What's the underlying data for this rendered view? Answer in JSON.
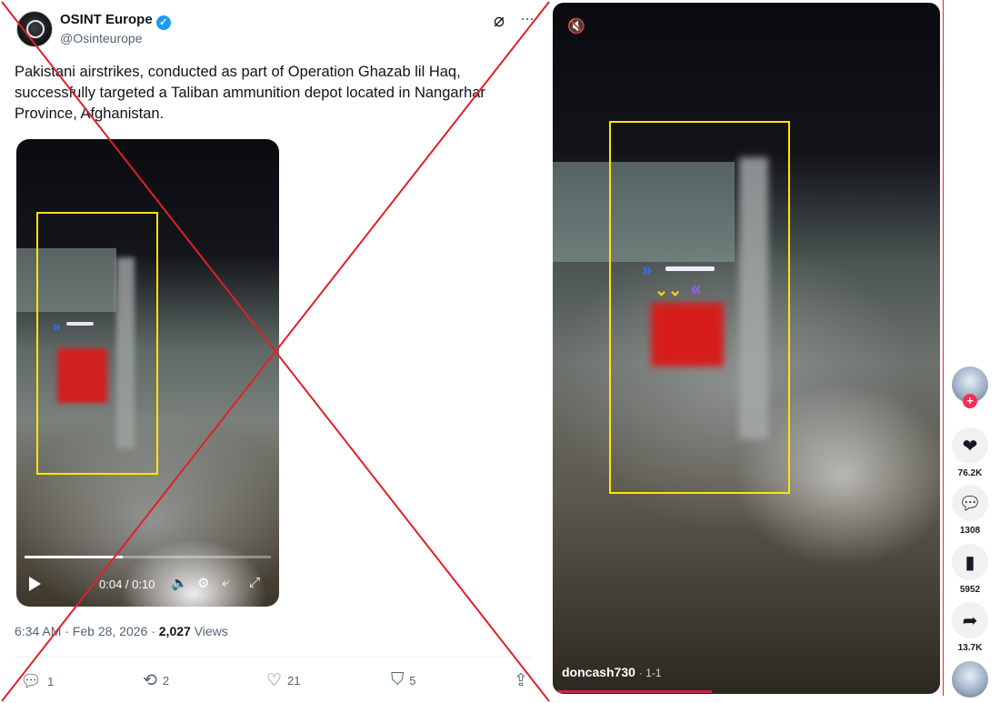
{
  "tweet": {
    "author_name": "OSINT Europe",
    "verified_mark": "✓",
    "author_handle": "@Osinteurope",
    "grok_icon": "⌀",
    "more_icon": "···",
    "text": "Pakistani airstrikes, conducted as part of Operation Ghazab lil Haq, successfully targeted a Taliban ammunition depot located in Nangarhar Province, Afghanistan.",
    "video": {
      "time": "0:04 / 0:10",
      "progress_fraction": 0.4,
      "controls": {
        "volume_icon": "🔈",
        "settings_icon": "⚙",
        "pip_icon": "⤶",
        "fullscreen_icon": "⤢"
      }
    },
    "timestamp": "6:34 AM · Feb 28, 2026 · ",
    "views_count": "2,027",
    "views_label": " Views",
    "actions": {
      "reply_count": "1",
      "repost_count": "2",
      "like_count": "21",
      "bookmark_count": "5"
    }
  },
  "tiktok": {
    "mute_icon": "🔇",
    "username": "doncash730",
    "date": "· 1-1",
    "progress_fraction": 0.41,
    "sidebar": {
      "follow_plus": "+",
      "likes": "76.2K",
      "comments": "1308",
      "saves": "5952",
      "shares": "13.7K"
    }
  },
  "colors": {
    "highlight_box": "#ffe600",
    "cross_mark": "#e0202a",
    "verified": "#1d9bf0",
    "tiktok_accent": "#fe2c55"
  }
}
